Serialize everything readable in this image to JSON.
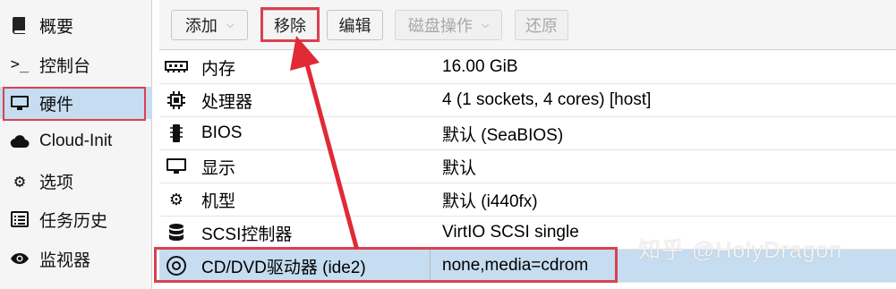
{
  "sidebar": {
    "items": [
      {
        "label": "概要",
        "icon": "book-icon"
      },
      {
        "label": "控制台",
        "icon": "terminal-icon"
      },
      {
        "label": "硬件",
        "icon": "monitor-icon",
        "active": true
      },
      {
        "label": "Cloud-Init",
        "icon": "cloud-icon"
      },
      {
        "label": "选项",
        "icon": "gear-icon"
      },
      {
        "label": "任务历史",
        "icon": "list-icon"
      },
      {
        "label": "监视器",
        "icon": "eye-icon"
      }
    ]
  },
  "toolbar": {
    "add_label": "添加",
    "remove_label": "移除",
    "edit_label": "编辑",
    "disk_ops_label": "磁盘操作",
    "revert_label": "还原"
  },
  "hardware": {
    "rows": [
      {
        "name": "内存",
        "value": "16.00 GiB",
        "icon": "memory-icon"
      },
      {
        "name": "处理器",
        "value": "4 (1 sockets, 4 cores) [host]",
        "icon": "cpu-icon"
      },
      {
        "name": "BIOS",
        "value": "默认 (SeaBIOS)",
        "icon": "bios-icon"
      },
      {
        "name": "显示",
        "value": "默认",
        "icon": "display-icon"
      },
      {
        "name": "机型",
        "value": "默认 (i440fx)",
        "icon": "machine-icon"
      },
      {
        "name": "SCSI控制器",
        "value": "VirtIO SCSI single",
        "icon": "database-icon"
      },
      {
        "name": "CD/DVD驱动器 (ide2)",
        "value": "none,media=cdrom",
        "icon": "cdrom-icon",
        "selected": true
      }
    ]
  },
  "watermark": "知乎 @HolyDragon",
  "colors": {
    "highlight_red": "#d9414f",
    "selection_blue": "#c6dcf0"
  }
}
